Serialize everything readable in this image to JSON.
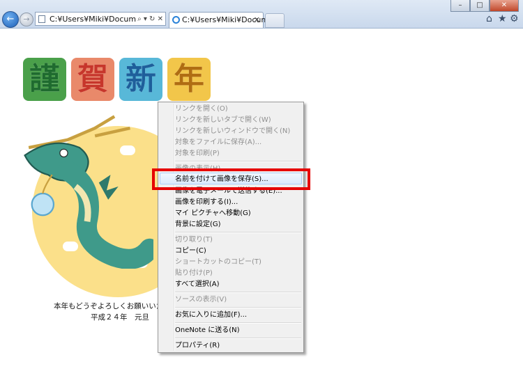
{
  "browser": {
    "window_buttons": {
      "minimize": "–",
      "maximize": "□",
      "close": "✕"
    },
    "back_glyph": "←",
    "forward_glyph": "→",
    "address": "C:¥Users¥Miki¥Documents¥",
    "address_tools": "⌕ ▾ ↻ ✕",
    "tab_title": "C:¥Users¥Miki¥Docume...",
    "tab_close": "✕",
    "home_icon": "⌂",
    "favorites_icon": "★",
    "tools_icon": "⚙"
  },
  "page": {
    "tiles": [
      "謹",
      "賀",
      "新",
      "年"
    ],
    "tile_colors": [
      "#4aa04a",
      "#e9896a",
      "#58b8d8",
      "#f2c64a"
    ],
    "tile_text_colors": [
      "#1f6b2f",
      "#c7362b",
      "#1e5f9b",
      "#b06d12"
    ],
    "greeting_line1": "本年もどうぞよろしくお願いいたします",
    "greeting_line2": "平成２４年　元旦"
  },
  "context_menu": {
    "items": [
      {
        "label": "リンクを開く(O)",
        "disabled": true
      },
      {
        "label": "リンクを新しいタブで開く(W)",
        "disabled": true
      },
      {
        "label": "リンクを新しいウィンドウで開く(N)",
        "disabled": true
      },
      {
        "label": "対象をファイルに保存(A)...",
        "disabled": true
      },
      {
        "label": "対象を印刷(P)",
        "disabled": true
      },
      {
        "label": "画像の表示(H)",
        "disabled": true
      },
      {
        "label": "名前を付けて画像を保存(S)...",
        "disabled": false
      },
      {
        "label": "画像を電子メールで送信する(E)...",
        "disabled": false
      },
      {
        "label": "画像を印刷する(I)...",
        "disabled": false
      },
      {
        "label": "マイ ピクチャへ移動(G)",
        "disabled": false
      },
      {
        "label": "背景に設定(G)",
        "disabled": false
      },
      {
        "label": "切り取り(T)",
        "disabled": true
      },
      {
        "label": "コピー(C)",
        "disabled": false
      },
      {
        "label": "ショートカットのコピー(T)",
        "disabled": true
      },
      {
        "label": "貼り付け(P)",
        "disabled": true
      },
      {
        "label": "すべて選択(A)",
        "disabled": false
      },
      {
        "label": "ソースの表示(V)",
        "disabled": true
      },
      {
        "label": "お気に入りに追加(F)...",
        "disabled": false
      },
      {
        "label": "OneNote に送る(N)",
        "disabled": false
      },
      {
        "label": "プロパティ(R)",
        "disabled": false
      }
    ],
    "highlighted_item": "名前を付けて画像を保存(S)...",
    "highlight_color": "#e60000"
  }
}
